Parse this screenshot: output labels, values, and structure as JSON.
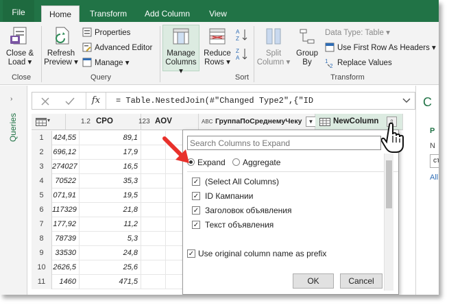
{
  "tabs": [
    {
      "label": "File"
    },
    {
      "label": "Home"
    },
    {
      "label": "Transform"
    },
    {
      "label": "Add Column"
    },
    {
      "label": "View"
    }
  ],
  "ribbon": {
    "close_load": {
      "line1": "Close &",
      "line2": "Load ▾"
    },
    "group_close": "Close",
    "refresh_preview": {
      "line1": "Refresh",
      "line2": "Preview ▾"
    },
    "properties": "Properties",
    "advanced_editor": "Advanced Editor",
    "manage": "Manage ▾",
    "group_query": "Query",
    "manage_columns": {
      "line1": "Manage",
      "line2": "Columns ▾"
    },
    "reduce_rows": {
      "line1": "Reduce",
      "line2": "Rows ▾"
    },
    "group_sort": "Sort",
    "split_column": {
      "line1": "Split",
      "line2": "Column ▾"
    },
    "group_by": {
      "line1": "Group",
      "line2": "By"
    },
    "data_type": "Data Type: Table ▾",
    "use_first_row": "Use First Row As Headers ▾",
    "replace_values": "Replace Values",
    "group_transform": "Transform"
  },
  "queries_label": "Queries",
  "formula_bar": {
    "fx": "fx",
    "formula": "= Table.NestedJoin(#\"Changed Type2\",{\"ID"
  },
  "grid": {
    "columns": [
      {
        "type": "",
        "name": ""
      },
      {
        "type": "1.2",
        "name": "CPO"
      },
      {
        "type": "123",
        "name": "AOV"
      },
      {
        "type": "ABC",
        "name": "ГруппаПоСреднемуЧеку"
      },
      {
        "type": "",
        "name": "NewColumn"
      }
    ],
    "rows": [
      {
        "n": "1",
        "a": "424,55",
        "b": "89,1"
      },
      {
        "n": "2",
        "a": "696,12",
        "b": "17,9"
      },
      {
        "n": "3",
        "a": "274027",
        "b": "16,5"
      },
      {
        "n": "4",
        "a": "70522",
        "b": "35,3"
      },
      {
        "n": "5",
        "a": "071,91",
        "b": "19,5"
      },
      {
        "n": "6",
        "a": "117329",
        "b": "21,8"
      },
      {
        "n": "7",
        "a": "177,92",
        "b": "11,2"
      },
      {
        "n": "8",
        "a": "78739",
        "b": "5,3"
      },
      {
        "n": "9",
        "a": "33530",
        "b": "24,8"
      },
      {
        "n": "10",
        "a": "2626,5",
        "b": "25,6"
      },
      {
        "n": "11",
        "a": "1460",
        "b": "471,5"
      }
    ]
  },
  "right_pane": {
    "line1": "С",
    "line2": "Р",
    "line3": "N",
    "box": "ст",
    "link": "All"
  },
  "popup": {
    "search_placeholder": "Search Columns to Expand",
    "expand": "Expand",
    "aggregate": "Aggregate",
    "items": [
      {
        "label": "(Select All Columns)",
        "checked": true
      },
      {
        "label": "ID Кампании",
        "checked": true
      },
      {
        "label": "Заголовок объявления",
        "checked": true
      },
      {
        "label": "Текст объявления",
        "checked": true
      }
    ],
    "prefix_label": "Use original column name as prefix",
    "ok": "OK",
    "cancel": "Cancel"
  },
  "colors": {
    "accent": "#217346",
    "arrow": "#e8312b"
  }
}
